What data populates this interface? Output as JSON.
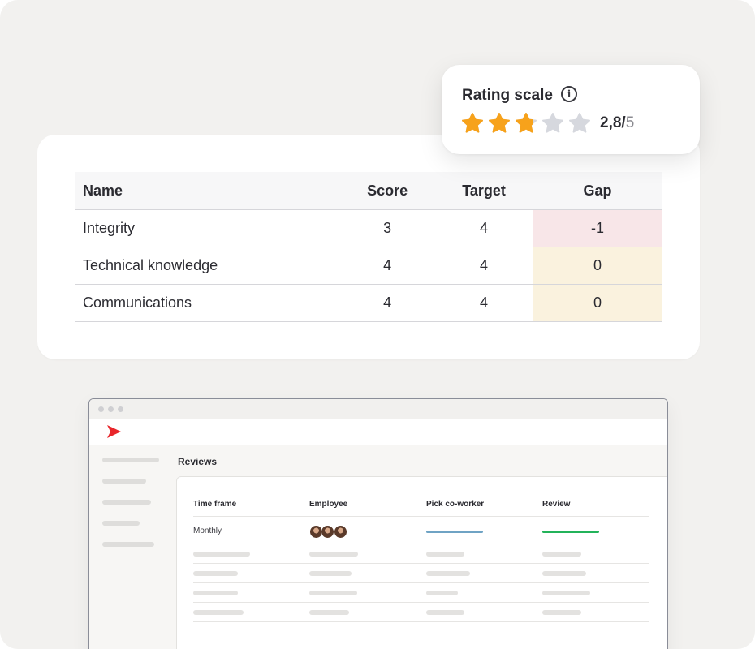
{
  "colors": {
    "star_filled": "#f7a21b",
    "star_empty": "#d6d8de",
    "gap_negative_bg": "#f8e6e8",
    "gap_zero_bg": "#faf2de",
    "brand_red": "#e8262b",
    "bar_blue": "#6fa3c4",
    "bar_green": "#23b35a"
  },
  "rating": {
    "title": "Rating scale",
    "info_icon": "info-icon",
    "value_label": "2,8/",
    "max_label": "5",
    "value": 2.8,
    "max": 5
  },
  "score_table": {
    "headers": {
      "name": "Name",
      "score": "Score",
      "target": "Target",
      "gap": "Gap"
    },
    "rows": [
      {
        "name": "Integrity",
        "score": "3",
        "target": "4",
        "gap": "-1",
        "gap_status": "negative"
      },
      {
        "name": "Technical knowledge",
        "score": "4",
        "target": "4",
        "gap": "0",
        "gap_status": "zero"
      },
      {
        "name": "Communications",
        "score": "4",
        "target": "4",
        "gap": "0",
        "gap_status": "zero"
      }
    ]
  },
  "app": {
    "logo_icon": "brand-logo-icon",
    "page_title": "Reviews",
    "columns": {
      "time_frame": "Time frame",
      "employee": "Employee",
      "pick_coworker": "Pick co-worker",
      "review": "Review"
    },
    "first_row": {
      "time_frame": "Monthly",
      "employee_avatars": 3
    }
  }
}
